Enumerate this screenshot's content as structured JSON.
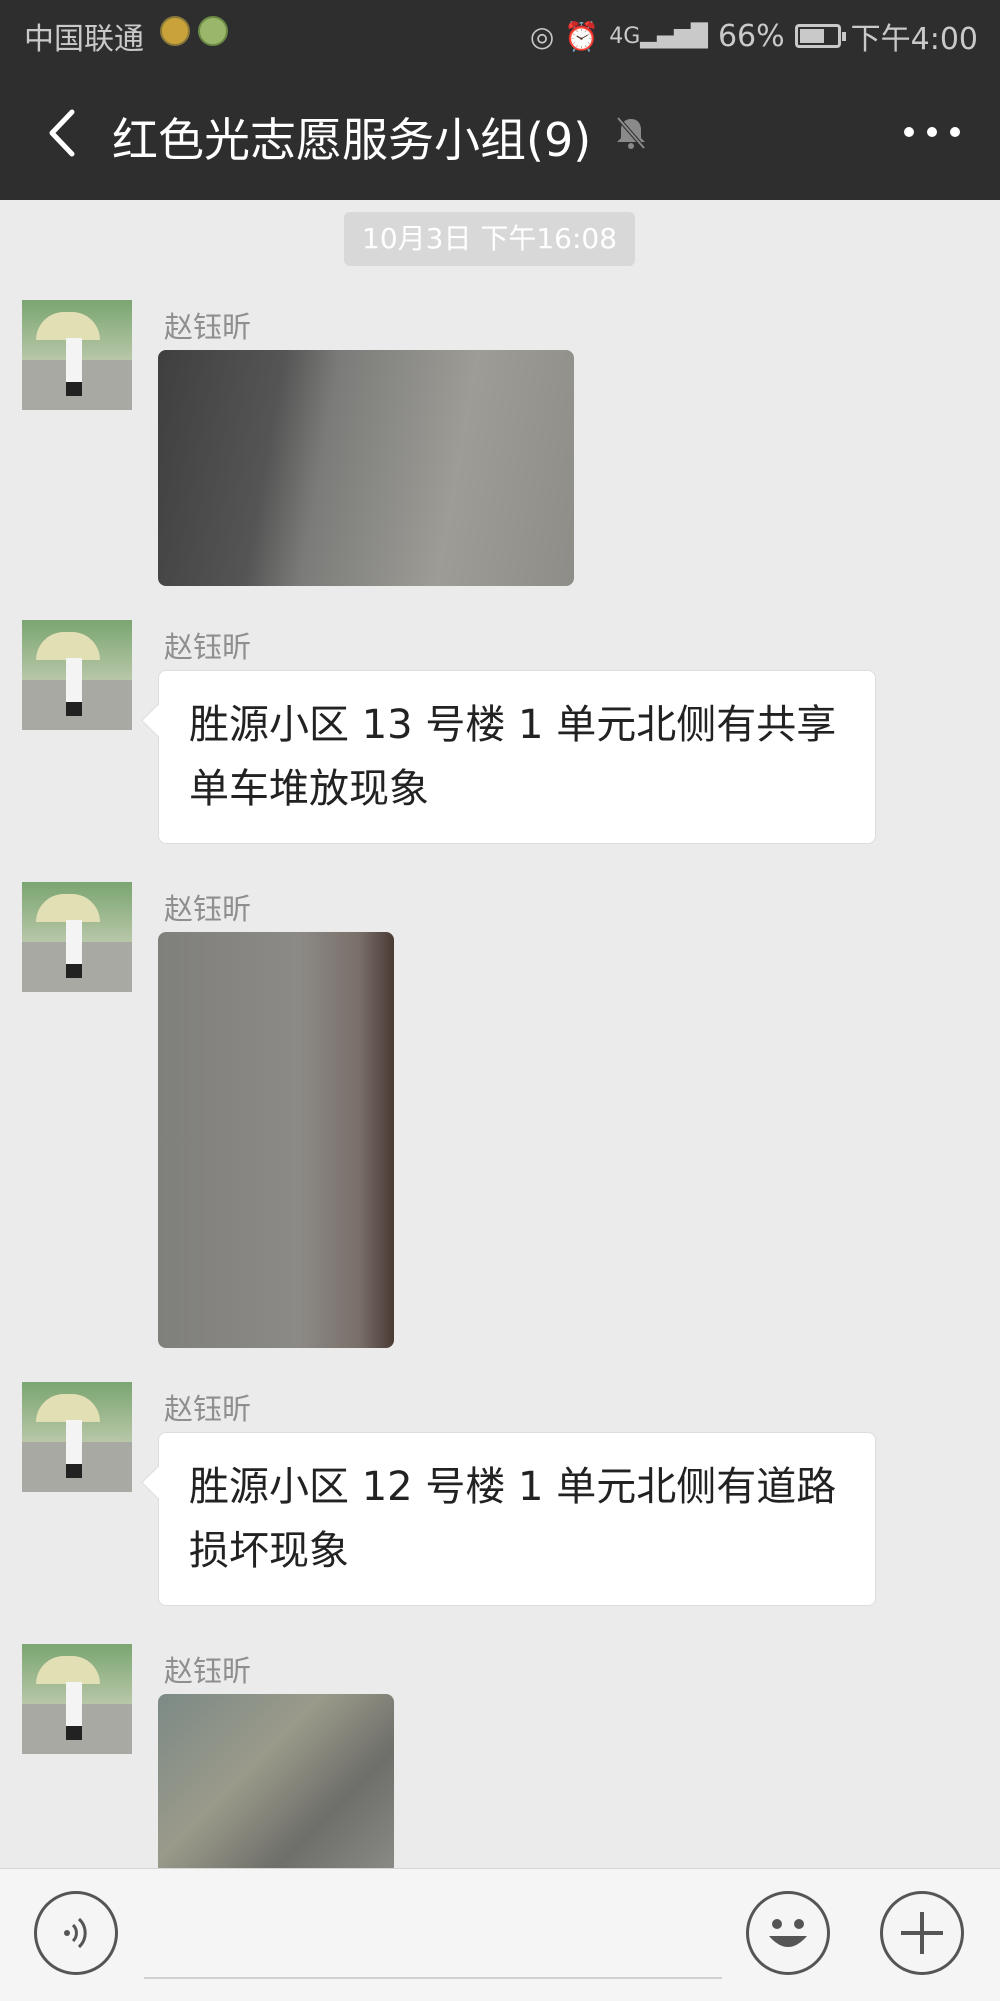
{
  "status_bar": {
    "carrier": "中国联通",
    "signal_network": "4G",
    "battery_percent": "66%",
    "battery_level": 0.66,
    "time": "下午4:00",
    "icons": [
      "wifi-icon",
      "alarm-icon",
      "signal-icon",
      "battery-icon"
    ]
  },
  "header": {
    "title": "红色光志愿服务小组(9)",
    "icons": [
      "back-icon",
      "mute-icon",
      "more-icon"
    ]
  },
  "timestamp": "10月3日 下午16:08",
  "messages": [
    {
      "sender": "赵钰昕",
      "type": "image"
    },
    {
      "sender": "赵钰昕",
      "type": "text",
      "text": "胜源小区 13 号楼 1 单元北侧有共享单车堆放现象"
    },
    {
      "sender": "赵钰昕",
      "type": "image"
    },
    {
      "sender": "赵钰昕",
      "type": "text",
      "text": "胜源小区 12 号楼 1 单元北侧有道路损坏现象"
    },
    {
      "sender": "赵钰昕",
      "type": "image"
    }
  ],
  "input_bar": {
    "icons": [
      "voice-icon",
      "emoji-icon",
      "plus-icon"
    ]
  }
}
